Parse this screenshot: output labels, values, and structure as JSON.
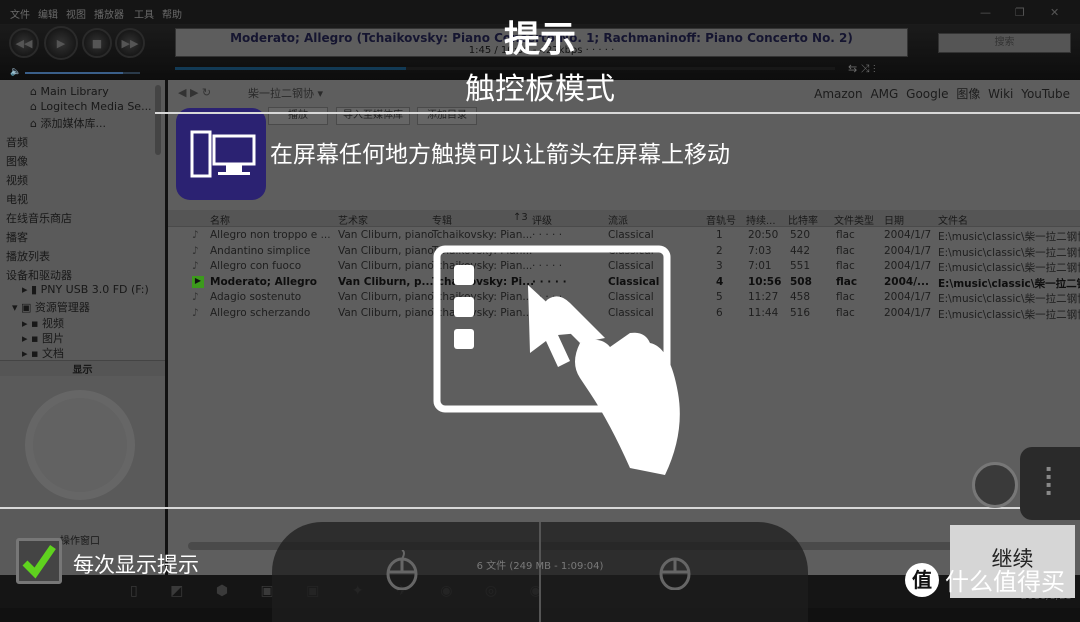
{
  "menu": [
    "文件",
    "编辑",
    "视图",
    "播放器",
    "工具",
    "帮助"
  ],
  "now_playing": {
    "title": "Moderato; Allegro (Tchaikovsky: Piano Concerto No. 1; Rachmaninoff: Piano Concerto No. 2)",
    "time": "1:45 / 10:56 - 427kbps",
    "rating": "· · · · ·",
    "progress": 0.35
  },
  "volume": 0.85,
  "search_placeholder": "搜索",
  "sidebar": {
    "libraries": [
      "Main Library",
      "Logitech Media Se...",
      "添加媒体库..."
    ],
    "sections": [
      "音频",
      "图像",
      "视频",
      "电视",
      "在线音乐商店",
      "播客",
      "播放列表",
      "设备和驱动器"
    ],
    "devices": [
      "PNY USB 3.0 FD (F:)",
      "资源管理器"
    ],
    "folders": [
      "视频",
      "图片",
      "文档"
    ],
    "display_label": "显示",
    "action_window": "操作窗口"
  },
  "view": {
    "tab": "柴一拉二钢协 ▾",
    "links": [
      "Amazon",
      "AMG",
      "Google",
      "图像",
      "Wiki",
      "YouTube"
    ],
    "buttons": [
      "播放",
      "导入至媒体库",
      "添加目录"
    ]
  },
  "columns": [
    "名称",
    "艺术家",
    "专辑",
    "↑3",
    "评级",
    "流派",
    "音轨号",
    "持续...",
    "比特率",
    "文件类型",
    "日期",
    "文件名"
  ],
  "tracks": [
    {
      "name": "Allegro non troppo e ...",
      "artist": "Van Cliburn, piano",
      "album": "Tchaikovsky: Pian...",
      "rating": "· · · · ·",
      "genre": "Classical",
      "track": "1",
      "duration": "20:50",
      "bitrate": "520",
      "type": "flac",
      "date": "2004/1/7",
      "file": "E:\\music\\classic\\柴一拉二钢协"
    },
    {
      "name": "Andantino simplice",
      "artist": "Van Cliburn, piano",
      "album": "Tchaikovsky: Pian...",
      "rating": "· · · · ·",
      "genre": "Classical",
      "track": "2",
      "duration": "7:03",
      "bitrate": "442",
      "type": "flac",
      "date": "2004/1/7",
      "file": "E:\\music\\classic\\柴一拉二钢协"
    },
    {
      "name": "Allegro con fuoco",
      "artist": "Van Cliburn, piano",
      "album": "Tchaikovsky: Pian...",
      "rating": "· · · · ·",
      "genre": "Classical",
      "track": "3",
      "duration": "7:01",
      "bitrate": "551",
      "type": "flac",
      "date": "2004/1/7",
      "file": "E:\\music\\classic\\柴一拉二钢协"
    },
    {
      "name": "Moderato; Allegro",
      "artist": "Van Cliburn, p...",
      "album": "Tchaikovsky: Pi...",
      "rating": "· · · · ·",
      "genre": "Classical",
      "track": "4",
      "duration": "10:56",
      "bitrate": "508",
      "type": "flac",
      "date": "2004/...",
      "file": "E:\\music\\classic\\柴一拉二钢协",
      "playing": true
    },
    {
      "name": "Adagio sostenuto",
      "artist": "Van Cliburn, piano",
      "album": "Tchaikovsky: Pian...",
      "rating": "· · · · ·",
      "genre": "Classical",
      "track": "5",
      "duration": "11:27",
      "bitrate": "458",
      "type": "flac",
      "date": "2004/1/7",
      "file": "E:\\music\\classic\\柴一拉二钢协"
    },
    {
      "name": "Allegro scherzando",
      "artist": "Van Cliburn, piano",
      "album": "Tchaikovsky: Pian...",
      "rating": "· · · · ·",
      "genre": "Classical",
      "track": "6",
      "duration": "11:44",
      "bitrate": "516",
      "type": "flac",
      "date": "2004/1/7",
      "file": "E:\\music\\classic\\柴一拉二钢协"
    }
  ],
  "status": "6 文件 (249 MB - 1:09:04)",
  "overlay": {
    "title": "提示",
    "subtitle": "触控板模式",
    "hint": "在屏幕任何地方触摸可以让箭头在屏幕上移动",
    "checkbox_label": "每次显示提示",
    "checkbox_checked": true,
    "continue": "继续"
  },
  "watermark": {
    "mark": "值",
    "text": "什么值得买"
  },
  "clock": "2016/8/23",
  "colors": {
    "check": "#5fd21e",
    "album": "#2b2272",
    "playing": "#3c9a1c"
  }
}
